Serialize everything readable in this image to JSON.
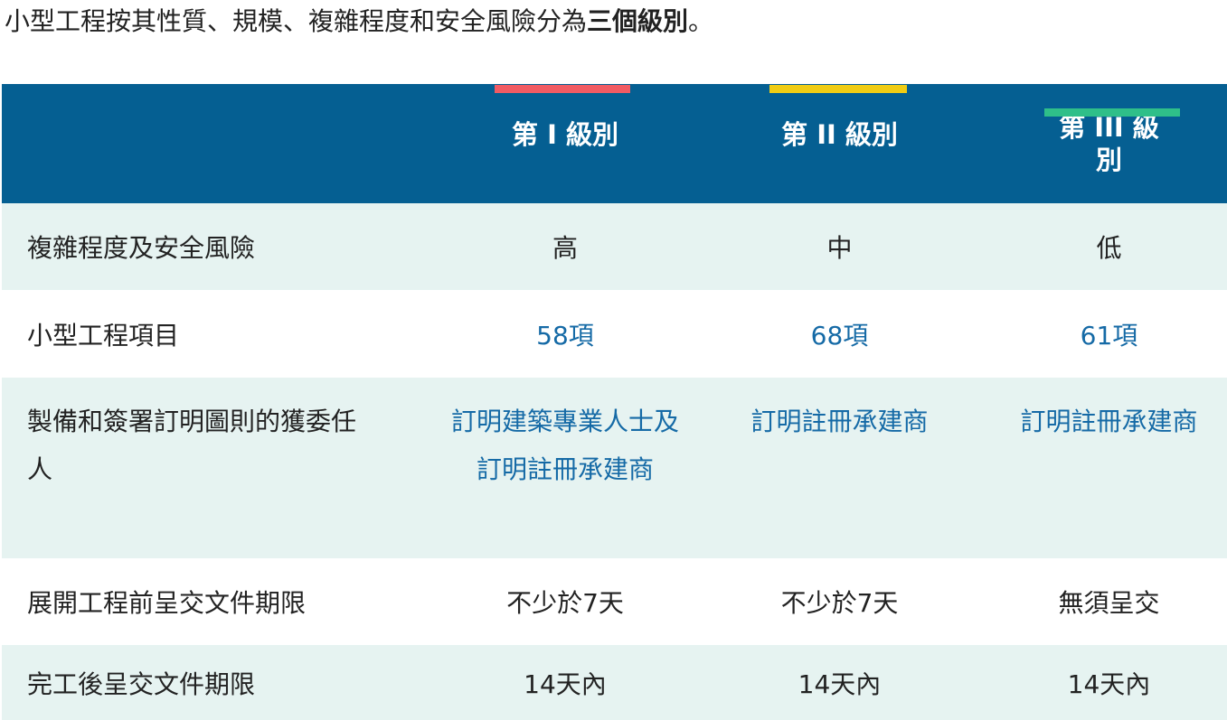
{
  "intro": {
    "text": "小型工程按其性質、規模、複雜程度和安全風險分為",
    "bold": "三個級別",
    "end": "。"
  },
  "table": {
    "headers": [
      "",
      "第 I 級別",
      "第 II 級別",
      "第 III 級別"
    ],
    "level_colors": [
      "#f15b63",
      "#f0cc13",
      "#2fbf89"
    ],
    "header_bg": "#055f92",
    "rows": [
      {
        "label": "複雜程度及安全風險",
        "values": [
          "高",
          "中",
          "低"
        ]
      },
      {
        "label": "小型工程項目",
        "values": [
          "58項",
          "68項",
          "61項"
        ]
      },
      {
        "label": "製備和簽署訂明圖則的獲委任人",
        "values": [
          "訂明建築專業人士及訂明註冊承建商",
          "訂明註冊承建商",
          "訂明註冊承建商"
        ]
      },
      {
        "label": "展開工程前呈交文件期限",
        "values": [
          "不少於7天",
          "不少於7天",
          "無須呈交"
        ]
      },
      {
        "label": "完工後呈交文件期限",
        "values": [
          "14天內",
          "14天內",
          "14天內"
        ]
      }
    ]
  }
}
